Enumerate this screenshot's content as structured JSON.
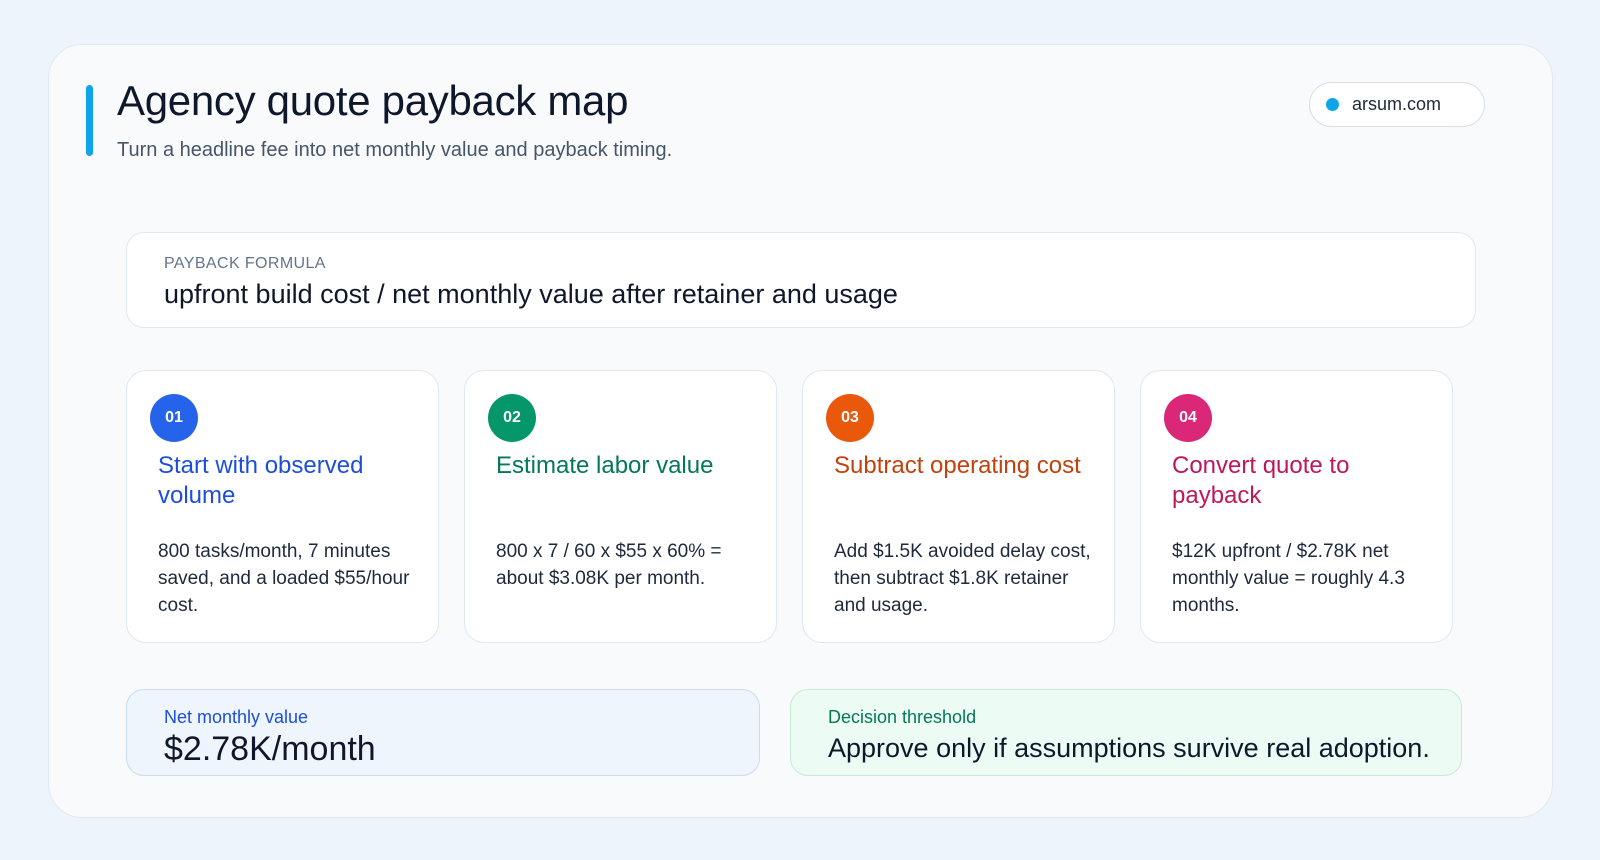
{
  "header": {
    "title": "Agency quote payback map",
    "subtitle": "Turn a headline fee into net monthly value and payback timing.",
    "brand": "arsum.com"
  },
  "formula": {
    "label": "PAYBACK FORMULA",
    "text": "upfront build cost / net monthly value after retainer and usage"
  },
  "steps": [
    {
      "number": "01",
      "title": "Start with observed volume",
      "body": "800 tasks/month, 7 minutes saved, and a loaded $55/hour cost.",
      "badge_color": "#2563eb",
      "title_color": "#1d4ed8"
    },
    {
      "number": "02",
      "title": "Estimate labor value",
      "body": "800 x 7 / 60 x $55 x 60% = about $3.08K per month.",
      "badge_color": "#059669",
      "title_color": "#047857"
    },
    {
      "number": "03",
      "title": "Subtract operating cost",
      "body": "Add $1.5K avoided delay cost, then subtract $1.8K retainer and usage.",
      "badge_color": "#ea580c",
      "title_color": "#c2410c"
    },
    {
      "number": "04",
      "title": "Convert quote to payback",
      "body": "$12K upfront / $2.78K net monthly value = roughly 4.3 months.",
      "badge_color": "#db2777",
      "title_color": "#be185d"
    }
  ],
  "metrics": {
    "net": {
      "label": "Net monthly value",
      "value": "$2.78K/month"
    },
    "threshold": {
      "label": "Decision threshold",
      "value": "Approve only if assumptions survive real adoption."
    }
  },
  "colors": {
    "accent": "#0ea5e9",
    "background": "#eef4fb"
  }
}
